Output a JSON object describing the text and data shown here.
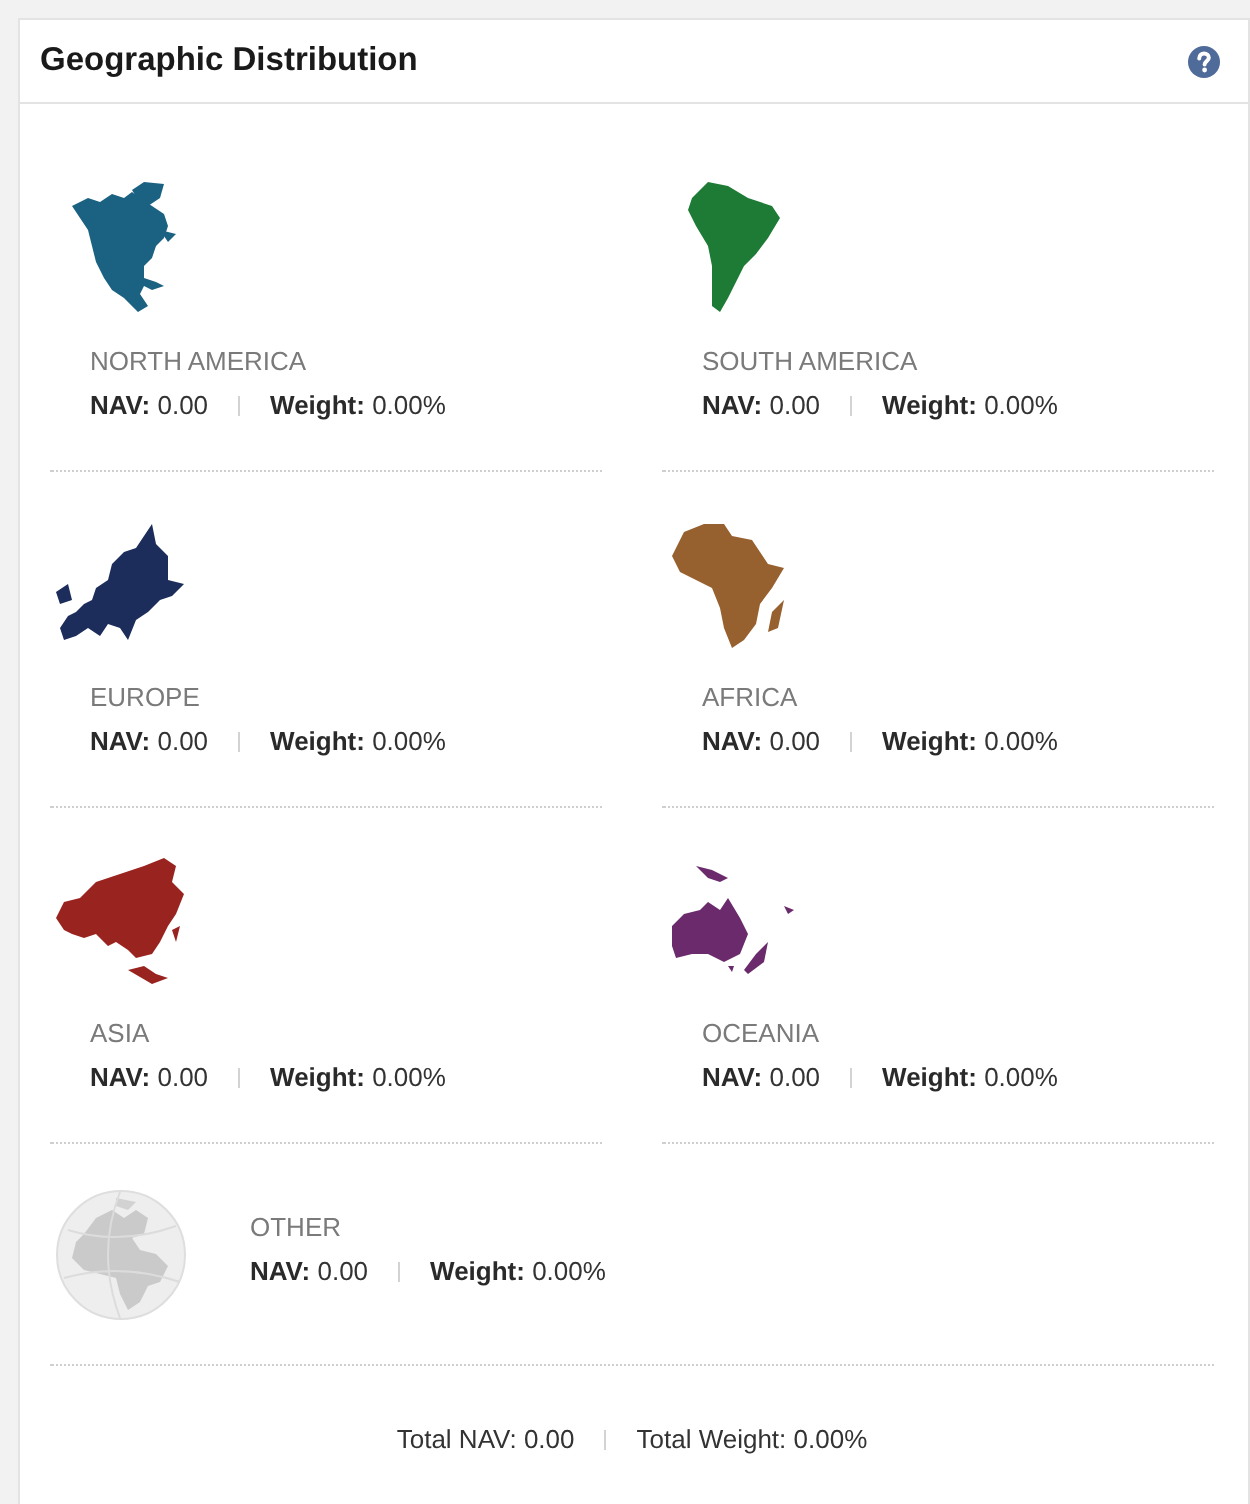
{
  "card": {
    "title": "Geographic Distribution"
  },
  "regions": [
    {
      "kind": "continent",
      "name": "NORTH AMERICA",
      "color": "#1b6282",
      "nav": "**NAV:** 0.00",
      "weight": "**Weight:** 0.00%"
    },
    {
      "kind": "continent",
      "name": "SOUTH AMERICA",
      "color": "#1e7b35",
      "nav": "**NAV:** 0.00",
      "weight": "**Weight:** 0.00%"
    },
    {
      "kind": "continent",
      "name": "EUROPE",
      "color": "#1c2c5b",
      "nav": "**NAV:** 0.00",
      "weight": "**Weight:** 0.00%"
    },
    {
      "kind": "continent",
      "name": "AFRICA",
      "color": "#97602f",
      "nav": "**NAV:** 0.00",
      "weight": "**Weight:** 0.00%"
    },
    {
      "kind": "continent",
      "name": "ASIA",
      "color": "#99231f",
      "nav": "**NAV:** 0.00",
      "weight": "**Weight:** 0.00%"
    },
    {
      "kind": "continent",
      "name": "OCEANIA",
      "color": "#6a2a6c",
      "nav": "**NAV:** 0.00",
      "weight": "**Weight:** 0.00%"
    },
    {
      "kind": "globe",
      "name": "OTHER",
      "nav": "**NAV:** 0.00",
      "weight": "**Weight:** 0.00%"
    }
  ],
  "totals": {
    "nav": "Total NAV: 0.00",
    "weight": "Total Weight: 0.00%"
  }
}
